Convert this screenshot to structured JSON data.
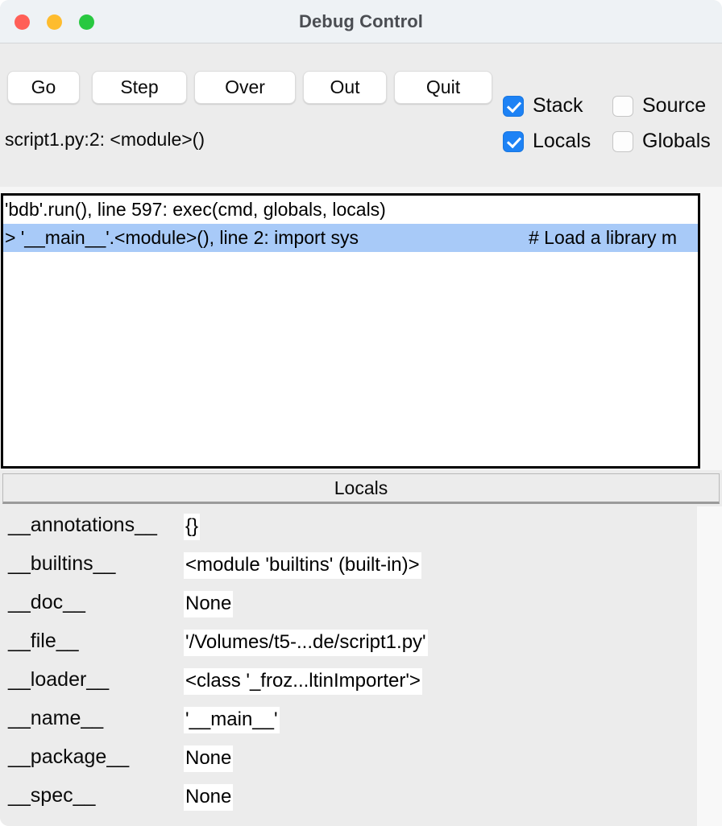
{
  "window": {
    "title": "Debug Control",
    "traffic_lights": [
      {
        "name": "close",
        "color": "#ff5f57"
      },
      {
        "name": "minimize",
        "color": "#febc2e"
      },
      {
        "name": "maximize",
        "color": "#28c840"
      }
    ]
  },
  "toolbar": {
    "buttons": [
      {
        "label": "Go"
      },
      {
        "label": "Step"
      },
      {
        "label": "Over"
      },
      {
        "label": "Out"
      },
      {
        "label": "Quit"
      }
    ],
    "checkboxes": [
      {
        "label": "Stack",
        "checked": true
      },
      {
        "label": "Locals",
        "checked": true
      },
      {
        "label": "Source",
        "checked": false
      },
      {
        "label": "Globals",
        "checked": false
      }
    ]
  },
  "status": {
    "text": "script1.py:2: <module>()"
  },
  "stack": {
    "rows": [
      {
        "text": "'bdb'.run(), line 597: exec(cmd, globals, locals)",
        "comment": "",
        "selected": false
      },
      {
        "text": "> '__main__'.<module>(), line 2: import sys",
        "comment": "# Load a library m",
        "selected": true
      }
    ],
    "selection_color": "#a8caf8"
  },
  "locals": {
    "header": "Locals",
    "rows": [
      {
        "key": "__annotations__",
        "value": "{}"
      },
      {
        "key": "__builtins__",
        "value": "<module 'builtins' (built-in)>"
      },
      {
        "key": "__doc__",
        "value": "None"
      },
      {
        "key": "__file__",
        "value": "'/Volumes/t5-...de/script1.py'"
      },
      {
        "key": "__loader__",
        "value": "<class '_froz...ltinImporter'>"
      },
      {
        "key": "__name__",
        "value": "'__main__'"
      },
      {
        "key": "__package__",
        "value": "None"
      },
      {
        "key": "__spec__",
        "value": "None"
      }
    ]
  }
}
